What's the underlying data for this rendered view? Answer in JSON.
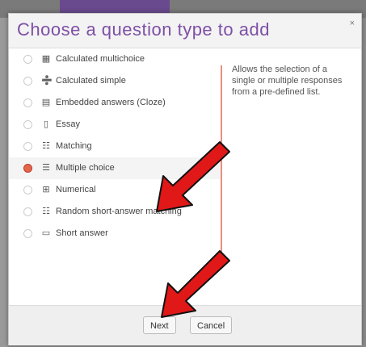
{
  "dialog": {
    "title": "Choose a question type to add",
    "close": "×",
    "options": [
      {
        "icon": "calc-multi-icon",
        "glyph": "▦",
        "label": "Calculated multichoice",
        "selected": false
      },
      {
        "icon": "calc-simple-icon",
        "glyph": "➗",
        "label": "Calculated simple",
        "selected": false
      },
      {
        "icon": "embedded-icon",
        "glyph": "▤",
        "label": "Embedded answers (Cloze)",
        "selected": false
      },
      {
        "icon": "essay-icon",
        "glyph": "▯",
        "label": "Essay",
        "selected": false
      },
      {
        "icon": "matching-icon",
        "glyph": "☷",
        "label": "Matching",
        "selected": false
      },
      {
        "icon": "multiple-choice-icon",
        "glyph": "☰",
        "label": "Multiple choice",
        "selected": true
      },
      {
        "icon": "numerical-icon",
        "glyph": "⊞",
        "label": "Numerical",
        "selected": false
      },
      {
        "icon": "random-match-icon",
        "glyph": "☷",
        "label": "Random short-answer matching",
        "selected": false
      },
      {
        "icon": "short-answer-icon",
        "glyph": "▭",
        "label": "Short answer",
        "selected": false
      }
    ],
    "description": "Allows the selection of a single or multiple responses from a pre-defined list.",
    "buttons": {
      "next": "Next",
      "cancel": "Cancel"
    }
  },
  "colors": {
    "title": "#7e4fa6",
    "arrow": "#e01818",
    "divider": "#e89080"
  }
}
